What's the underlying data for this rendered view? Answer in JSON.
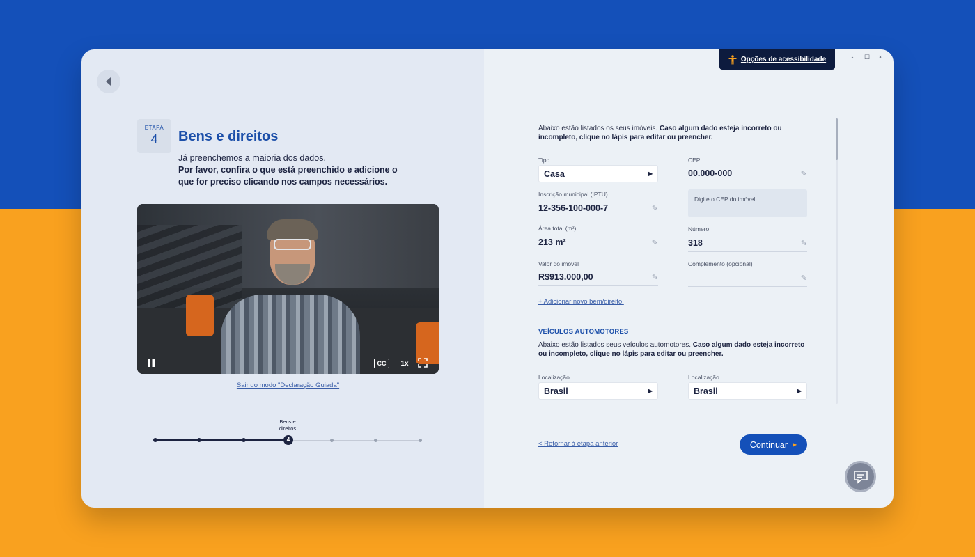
{
  "colors": {
    "brand_blue": "#1450b9",
    "brand_orange": "#f9a11f",
    "navy": "#0d1b3e"
  },
  "icons": {
    "back": "back-arrow-icon",
    "accessibility": "accessibility-person-icon",
    "pencil": "pencil-icon",
    "chat": "chat-icon"
  },
  "window_controls": {
    "minimize": "-",
    "maximize": "☐",
    "close": "×"
  },
  "accessibility": {
    "label": "Opções de acessibilidade"
  },
  "step": {
    "badge_label": "ETAPA",
    "number": "4",
    "title": "Bens e direitos",
    "intro_line1": "Já preenchemos a maioria dos dados.",
    "intro_bold": "Por favor, confira o que está preenchido e adicione o que for preciso clicando nos campos necessários."
  },
  "video": {
    "cc": "CC",
    "speed": "1x"
  },
  "exit_link": "Sair do modo \"Declaração Guiada\"",
  "progress": {
    "current_label_line1": "Bens e",
    "current_label_line2": "direitos",
    "current": "4",
    "total_steps": 7,
    "current_step": 4
  },
  "imoveis": {
    "desc_normal": "Abaixo estão listados os seus imóveis. ",
    "desc_bold": "Caso algum dado esteja incorreto ou incompleto, clique no lápis para editar ou preencher.",
    "tipo": {
      "label": "Tipo",
      "value": "Casa"
    },
    "cep": {
      "label": "CEP",
      "value": "00.000-000",
      "help": "Digite o CEP do imóvel"
    },
    "iptu": {
      "label": "Inscrição municipal (IPTU)",
      "value": "12-356-100-000-7"
    },
    "area": {
      "label": "Área total (m²)",
      "value": "213 m²"
    },
    "numero": {
      "label": "Número",
      "value": "318"
    },
    "valor": {
      "label": "Valor do imóvel",
      "value": "R$913.000,00"
    },
    "complemento": {
      "label": "Complemento (opcional)",
      "value": ""
    },
    "add_link": "+ Adicionar novo bem/direito."
  },
  "veiculos": {
    "title": "VEÍCULOS AUTOMOTORES",
    "desc_normal": "Abaixo estão listados seus veículos automotores. ",
    "desc_bold": "Caso algum dado esteja incorreto ou incompleto, clique no lápis para editar ou preencher.",
    "loc1": {
      "label": "Localização",
      "value": "Brasil"
    },
    "loc2": {
      "label": "Localização",
      "value": "Brasil"
    }
  },
  "footer": {
    "return_link": "< Retornar à etapa anterior",
    "continue": "Continuar"
  }
}
